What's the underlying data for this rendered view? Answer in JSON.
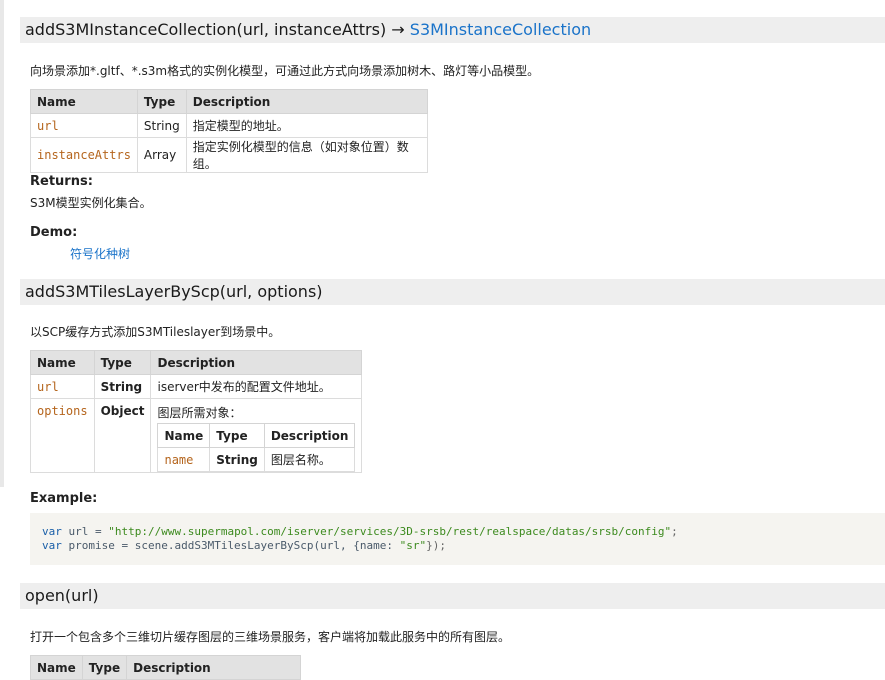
{
  "methods": [
    {
      "name_sig": "addS3MInstanceCollection(url, instanceAttrs)",
      "arrow": "→",
      "return_type": "S3MInstanceCollection",
      "description": "向场景添加*.gltf、*.s3m格式的实例化模型，可通过此方式向场景添加树木、路灯等小品模型。",
      "params_header": [
        "Name",
        "Type",
        "Description"
      ],
      "params": [
        {
          "name": "url",
          "type": "String",
          "desc": "指定模型的地址。"
        },
        {
          "name": "instanceAttrs",
          "type": "Array",
          "desc": "指定实例化模型的信息（如对象位置）数组。"
        }
      ],
      "returns_label": "Returns:",
      "returns_text": "S3M模型实例化集合。",
      "demo_label": "Demo:",
      "demo_link": "符号化种树"
    },
    {
      "name_sig": "addS3MTilesLayerByScp(url, options)",
      "description": "以SCP缓存方式添加S3MTileslayer到场景中。",
      "params_header": [
        "Name",
        "Type",
        "Description"
      ],
      "params": [
        {
          "name": "url",
          "type": "String",
          "desc": "iserver中发布的配置文件地址。"
        },
        {
          "name": "options",
          "type": "Object",
          "desc": "图层所需对象："
        }
      ],
      "inner_header": [
        "Name",
        "Type",
        "Description"
      ],
      "inner_params": [
        {
          "name": "name",
          "type": "String",
          "desc": "图层名称。"
        }
      ],
      "example_label": "Example:",
      "code": {
        "line1_kw": "var",
        "line1_var": " url = ",
        "line1_str": "\"http://www.supermapol.com/iserver/services/3D-srsb/rest/realspace/datas/srsb/config\"",
        "line1_end": ";",
        "line2_kw": "var",
        "line2_a": " promise = scene.addS3MTilesLayerByScp(url, {name: ",
        "line2_str": "\"sr\"",
        "line2_end": "});"
      }
    },
    {
      "name_sig": "open(url)",
      "description": "打开一个包含多个三维切片缓存图层的三维场景服务，客户端将加载此服务中的所有图层。",
      "params_header": [
        "Name",
        "Type",
        "Description"
      ]
    }
  ]
}
